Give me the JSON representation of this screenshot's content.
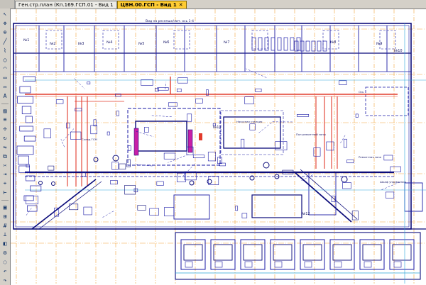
{
  "tabs": [
    {
      "label": "Ген.стр.план (Кп.169.ГСП.01 - Вид 1",
      "active": false
    },
    {
      "label": "ЦВН.00.ГСП - Вид 1",
      "active": true
    }
  ],
  "toolbar": {
    "icons": [
      "arrow-icon",
      "pan-icon",
      "zoom-icon",
      "line-icon",
      "polyline-icon",
      "circle-icon",
      "arc-icon",
      "rect-icon",
      "dimension-icon",
      "text-icon",
      "hatch-icon",
      "layer-icon",
      "move-icon",
      "rotate-icon",
      "mirror-icon",
      "copy-icon",
      "trim-icon",
      "extend-icon",
      "snap-icon",
      "measure-icon",
      "block-icon",
      "insert-icon",
      "grid-icon",
      "ortho-icon",
      "fill-icon",
      "properties-icon",
      "hide-icon",
      "undo-icon",
      "redo-icon"
    ]
  },
  "drawing": {
    "title_line": "Вид на ресепшн/лит. ось 1-4",
    "room_labels": [
      "№1",
      "№2",
      "№3",
      "№4",
      "№5",
      "№6",
      "№7",
      "№8",
      "№9",
      "№10",
      "№11",
      "№12"
    ],
    "annotations": [
      "Насосная станция",
      "Склад ГСМ",
      "Пол ремонтной зоны",
      "Ремонтная зона",
      "Шкаф управления",
      "Ось"
    ],
    "colors": {
      "blue": "#1a1aa6",
      "navy": "#0b0b7a",
      "red": "#e23b2c",
      "orange": "#f2a33a",
      "cyan": "#2aa6d9",
      "magenta": "#c81fa6"
    }
  }
}
